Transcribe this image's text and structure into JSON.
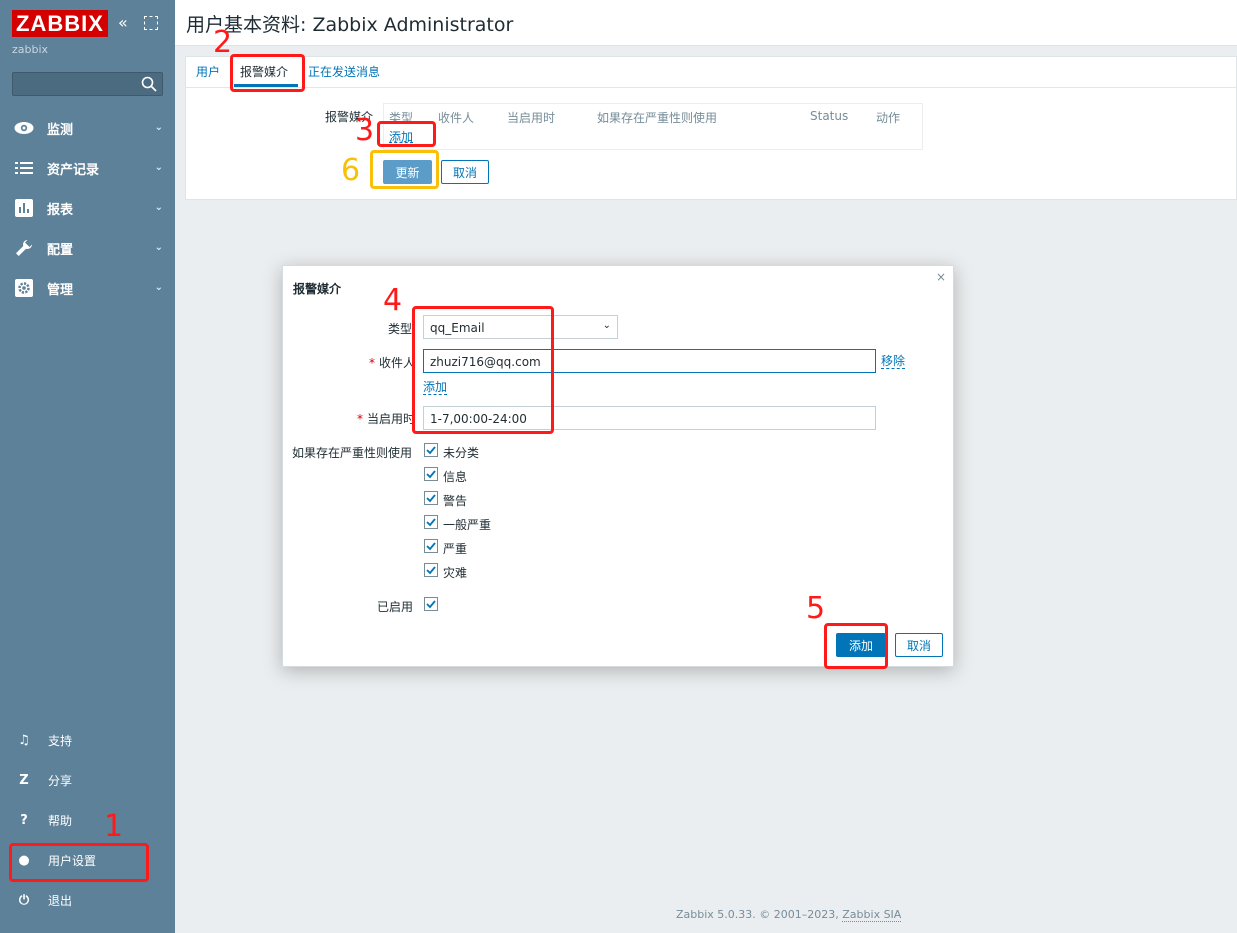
{
  "sidebar": {
    "logo": "ZABBIX",
    "collapse_glyph": "«",
    "server_name": "zabbix",
    "search_placeholder": "",
    "menu": [
      {
        "label": "监测",
        "icon": "eye-icon"
      },
      {
        "label": "资产记录",
        "icon": "list-icon"
      },
      {
        "label": "报表",
        "icon": "bar-chart-icon"
      },
      {
        "label": "配置",
        "icon": "wrench-icon"
      },
      {
        "label": "管理",
        "icon": "gear-icon"
      }
    ],
    "bottom": [
      {
        "label": "支持",
        "icon": "headset-icon",
        "glyph": "♫"
      },
      {
        "label": "分享",
        "icon": "share-icon",
        "glyph": "Z"
      },
      {
        "label": "帮助",
        "icon": "help-icon",
        "glyph": "?"
      },
      {
        "label": "用户设置",
        "icon": "user-icon",
        "glyph": "●"
      },
      {
        "label": "退出",
        "icon": "power-icon",
        "glyph": "⏻"
      }
    ]
  },
  "header": {
    "title": "用户基本资料: Zabbix Administrator"
  },
  "tabs": [
    {
      "label": "用户"
    },
    {
      "label": "报警媒介"
    },
    {
      "label": "正在发送消息"
    }
  ],
  "media": {
    "label": "报警媒介",
    "columns": [
      "类型",
      "收件人",
      "当启用时",
      "如果存在严重性则使用",
      "Status",
      "动作"
    ],
    "add_link": "添加"
  },
  "buttons": {
    "update": "更新",
    "cancel": "取消"
  },
  "dialog": {
    "close_glyph": "×",
    "title": "报警媒介",
    "type_label": "类型",
    "type_value": "qq_Email",
    "sendto_label": "收件人",
    "sendto_value": "zhuzi716@qq.com",
    "remove_link": "移除",
    "add_link": "添加",
    "when_active_label": "当启用时",
    "when_active_value": "1-7,00:00-24:00",
    "severity_label": "如果存在严重性则使用",
    "severities": [
      {
        "label": "未分类",
        "checked": true
      },
      {
        "label": "信息",
        "checked": true
      },
      {
        "label": "警告",
        "checked": true
      },
      {
        "label": "一般严重",
        "checked": true
      },
      {
        "label": "严重",
        "checked": true
      },
      {
        "label": "灾难",
        "checked": true
      }
    ],
    "enabled_label": "已启用",
    "enabled": true,
    "add_button": "添加",
    "cancel_button": "取消"
  },
  "footer": {
    "text": "Zabbix 5.0.33. © 2001–2023, ",
    "company": "Zabbix SIA"
  },
  "annotations": [
    "1",
    "2",
    "3",
    "4",
    "5",
    "6"
  ],
  "colors": {
    "sidebar": "#5d8199",
    "logo": "#d40000",
    "accent": "#0275b8",
    "annotation_red": "#ff1a1a",
    "annotation_yellow": "#f8c00a"
  }
}
